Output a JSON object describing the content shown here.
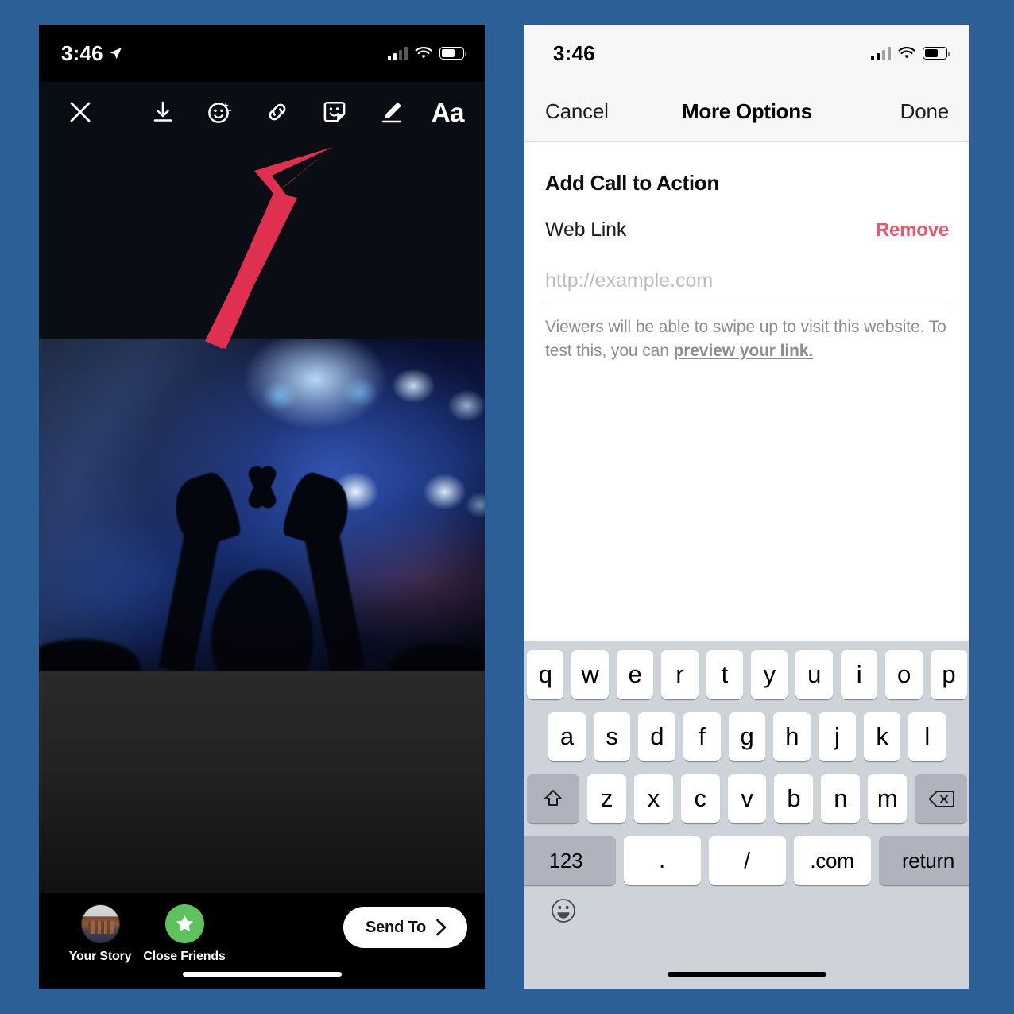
{
  "background_color": "#2c5f96",
  "left_phone": {
    "status_bar": {
      "time": "3:46",
      "location_icon": "location-arrow-icon",
      "signal_icon": "cellular-signal-icon",
      "wifi_icon": "wifi-icon",
      "battery_icon": "battery-icon"
    },
    "toolbar": {
      "close_icon": "close-x-icon",
      "items": [
        {
          "name": "save-icon",
          "label": "Save"
        },
        {
          "name": "effects-icon",
          "label": "Effects"
        },
        {
          "name": "link-icon",
          "label": "Link"
        },
        {
          "name": "sticker-icon",
          "label": "Sticker"
        },
        {
          "name": "draw-icon",
          "label": "Draw"
        },
        {
          "name": "text-icon",
          "label": "Aa"
        }
      ],
      "text_tool_label": "Aa"
    },
    "annotation": {
      "arrow_color": "#e03050",
      "points_to": "link-icon"
    },
    "photo": {
      "description": "Concert crowd silhouette with hands forming a heart against blue stage lights"
    },
    "bottom_bar": {
      "your_story_label": "Your Story",
      "close_friends_label": "Close Friends",
      "send_to_label": "Send To",
      "send_to_chevron": "chevron-right-icon",
      "star_icon": "star-icon"
    }
  },
  "right_phone": {
    "status_bar": {
      "time": "3:46",
      "signal_icon": "cellular-signal-icon",
      "wifi_icon": "wifi-icon",
      "battery_icon": "battery-icon"
    },
    "nav_bar": {
      "cancel_label": "Cancel",
      "title": "More Options",
      "done_label": "Done"
    },
    "form": {
      "section_title": "Add Call to Action",
      "field_label": "Web Link",
      "remove_label": "Remove",
      "remove_color": "#e8566b",
      "url_value": "",
      "url_placeholder": "http://example.com",
      "helper_text_before": "Viewers will be able to swipe up to visit this website. To test this, you can ",
      "helper_link": "preview your link."
    },
    "keyboard": {
      "row1": [
        "q",
        "w",
        "e",
        "r",
        "t",
        "y",
        "u",
        "i",
        "o",
        "p"
      ],
      "row2": [
        "a",
        "s",
        "d",
        "f",
        "g",
        "h",
        "j",
        "k",
        "l"
      ],
      "row3_shift_icon": "shift-icon",
      "row3": [
        "z",
        "x",
        "c",
        "v",
        "b",
        "n",
        "m"
      ],
      "row3_delete_icon": "delete-backspace-icon",
      "row4": {
        "numbers_label": "123",
        "period_label": ".",
        "slash_label": "/",
        "dotcom_label": ".com",
        "return_label": "return"
      },
      "emoji_icon": "emoji-smiley-icon"
    }
  }
}
